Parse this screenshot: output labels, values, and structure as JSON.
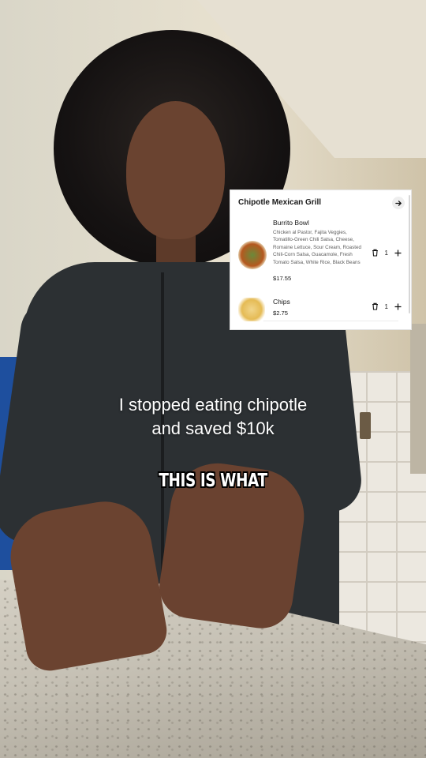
{
  "order_card": {
    "restaurant": "Chipotle Mexican Grill",
    "items": [
      {
        "name": "Burrito Bowl",
        "description": "Chicken al Pastor, Fajita Veggies, Tomatillo-Green Chili Salsa, Cheese, Romaine Lettuce, Sour Cream, Roasted Chili-Corn Salsa, Guacamole, Fresh Tomato Salsa, White Rice, Black Beans",
        "price": "$17.55",
        "quantity": "1"
      },
      {
        "name": "Chips",
        "description": "",
        "price": "$2.75",
        "quantity": "1"
      }
    ],
    "icons": {
      "arrow": "arrow-right-icon",
      "trash": "trash-icon",
      "plus": "plus-icon"
    }
  },
  "captions": {
    "line1": "I stopped eating chipotle",
    "line2": "and saved $10k"
  },
  "overlay": {
    "text": "THIS IS WHAT"
  },
  "colors": {
    "card_bg": "#ffffff",
    "text": "#191919",
    "muted": "#5f5f5f"
  }
}
